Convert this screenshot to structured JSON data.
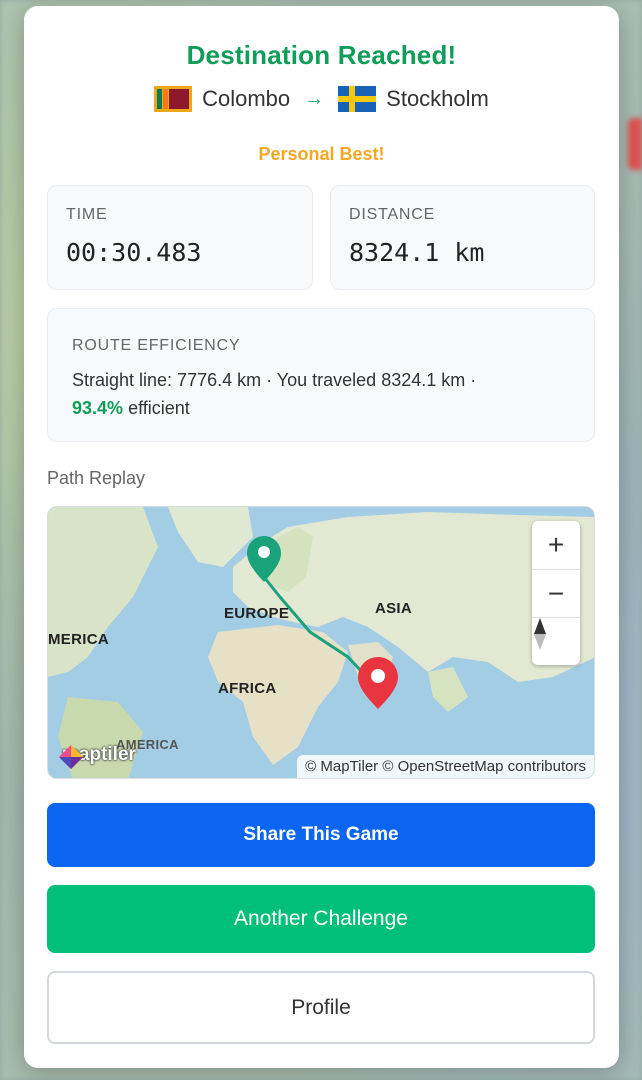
{
  "title": "Destination Reached!",
  "route": {
    "from": "Colombo",
    "arrow": "→",
    "to": "Stockholm"
  },
  "badge": "Personal Best!",
  "stats": {
    "time_label": "TIME",
    "time_value": "00:30.483",
    "distance_label": "DISTANCE",
    "distance_value": "8324.1 km"
  },
  "efficiency": {
    "label": "ROUTE EFFICIENCY",
    "text": "Straight line: 7776.4 km · You traveled 8324.1 km ·",
    "percent": "93.4%",
    "suffix": "efficient"
  },
  "path_replay": {
    "label": "Path Replay",
    "map_labels": {
      "europe": "EUROPE",
      "asia": "ASIA",
      "america": "MERICA",
      "africa": "AFRICA",
      "south_america": "AMERICA"
    },
    "logo": "maptiler",
    "attribution": "© MapTiler © OpenStreetMap contributors",
    "controls": {
      "zoom_in": "+",
      "zoom_out": "−"
    }
  },
  "buttons": {
    "share": "Share This Game",
    "challenge": "Another Challenge",
    "profile": "Profile"
  },
  "colors": {
    "success": "#0f9d58",
    "highlight": "#f5a623",
    "primary": "#0a66f2",
    "accent": "#00bf78",
    "route_line": "#1aa27a",
    "start_pin": "#1aa27a",
    "end_pin": "#e8353f"
  }
}
